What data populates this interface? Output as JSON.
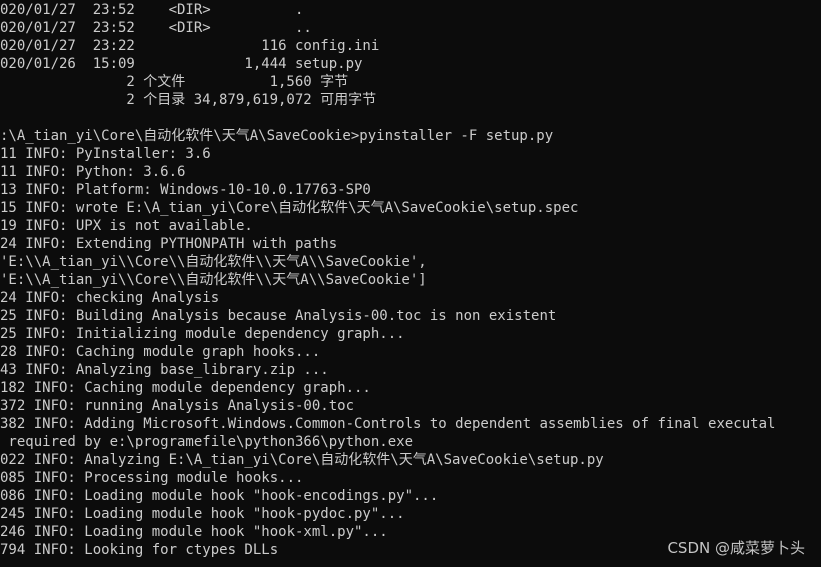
{
  "terminal": {
    "lines": [
      "020/01/27  23:52    <DIR>          .",
      "020/01/27  23:52    <DIR>          ..",
      "020/01/27  23:22               116 config.ini",
      "020/01/26  15:09             1,444 setup.py",
      "               2 个文件          1,560 字节",
      "               2 个目录 34,879,619,072 可用字节",
      "",
      ":\\A_tian_yi\\Core\\自动化软件\\天气A\\SaveCookie>pyinstaller -F setup.py",
      "11 INFO: PyInstaller: 3.6",
      "11 INFO: Python: 3.6.6",
      "13 INFO: Platform: Windows-10-10.0.17763-SP0",
      "15 INFO: wrote E:\\A_tian_yi\\Core\\自动化软件\\天气A\\SaveCookie\\setup.spec",
      "19 INFO: UPX is not available.",
      "24 INFO: Extending PYTHONPATH with paths",
      "'E:\\\\A_tian_yi\\\\Core\\\\自动化软件\\\\天气A\\\\SaveCookie',",
      "'E:\\\\A_tian_yi\\\\Core\\\\自动化软件\\\\天气A\\\\SaveCookie']",
      "24 INFO: checking Analysis",
      "25 INFO: Building Analysis because Analysis-00.toc is non existent",
      "25 INFO: Initializing module dependency graph...",
      "28 INFO: Caching module graph hooks...",
      "43 INFO: Analyzing base_library.zip ...",
      "182 INFO: Caching module dependency graph...",
      "372 INFO: running Analysis Analysis-00.toc",
      "382 INFO: Adding Microsoft.Windows.Common-Controls to dependent assemblies of final executal",
      " required by e:\\programefile\\python366\\python.exe",
      "022 INFO: Analyzing E:\\A_tian_yi\\Core\\自动化软件\\天气A\\SaveCookie\\setup.py",
      "085 INFO: Processing module hooks...",
      "086 INFO: Loading module hook \"hook-encodings.py\"...",
      "245 INFO: Loading module hook \"hook-pydoc.py\"...",
      "246 INFO: Loading module hook \"hook-xml.py\"...",
      "794 INFO: Looking for ctypes DLLs"
    ]
  },
  "watermark": {
    "text": "CSDN @咸菜萝卜头"
  }
}
